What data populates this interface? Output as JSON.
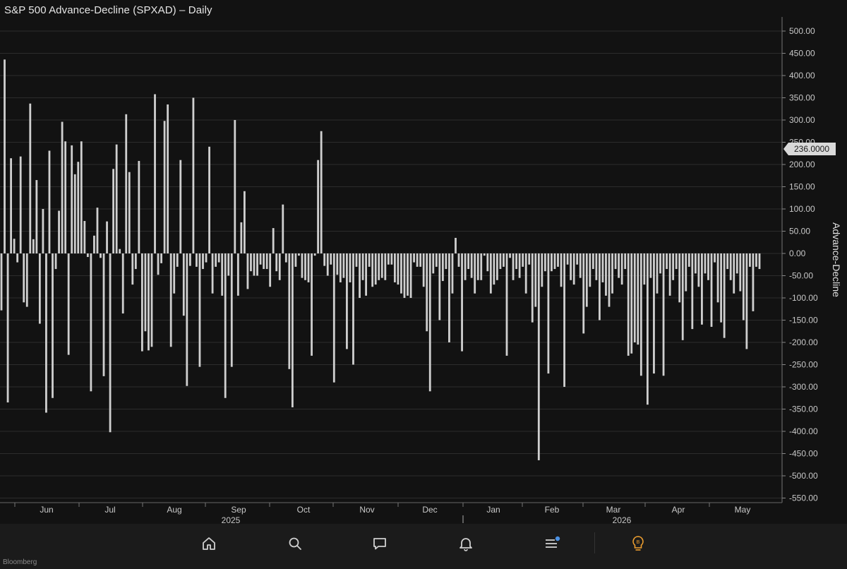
{
  "title": "S&P 500 Advance-Decline (SPXAD) – Daily",
  "brand": "Bloomberg",
  "colors": {
    "background": "#121212",
    "bar": "#cfcfcf",
    "grid": "#2c2c2c",
    "marker_bg": "#d9d9d9",
    "accent_dot": "#4a90e2",
    "brand_icon": "#f0a030"
  },
  "nav": [
    {
      "name": "home-icon"
    },
    {
      "name": "search-icon"
    },
    {
      "name": "chat-icon"
    },
    {
      "name": "bell-icon"
    },
    {
      "name": "menu-icon",
      "badge": true
    },
    {
      "name": "bulb-icon"
    }
  ],
  "chart_data": {
    "type": "bar",
    "ylabel": "Advance-Decline",
    "ylim": [
      -550,
      500
    ],
    "yticks": [
      "500.00",
      "450.00",
      "400.00",
      "350.00",
      "300.00",
      "250.00",
      "200.00",
      "150.00",
      "100.00",
      "50.00",
      "0.00",
      "-50.00",
      "-100.00",
      "-150.00",
      "-200.00",
      "-250.00",
      "-300.00",
      "-350.00",
      "-400.00",
      "-450.00",
      "-500.00",
      "-550.00"
    ],
    "last_value_label": "236.0000",
    "grid": true,
    "x_months": [
      "Jun",
      "Jul",
      "Aug",
      "Sep",
      "Oct",
      "Nov",
      "Dec",
      "Jan",
      "Feb",
      "Mar",
      "Apr",
      "May"
    ],
    "x_years": [
      "2025",
      "2026"
    ],
    "values": [
      -128,
      436,
      -335,
      214,
      33,
      -20,
      218,
      -110,
      -120,
      337,
      32,
      165,
      -158,
      100,
      -358,
      231,
      -325,
      -35,
      96,
      296,
      252,
      -228,
      243,
      178,
      206,
      252,
      73,
      -8,
      -310,
      40,
      103,
      -10,
      -276,
      72,
      -402,
      190,
      245,
      10,
      -135,
      313,
      183,
      -70,
      -35,
      208,
      -220,
      -175,
      -218,
      -210,
      358,
      -48,
      -22,
      298,
      335,
      -210,
      -90,
      -30,
      210,
      -140,
      -298,
      -28,
      350,
      -30,
      -255,
      -35,
      -20,
      240,
      -90,
      -30,
      -20,
      -95,
      -325,
      -50,
      -255,
      300,
      -95,
      70,
      140,
      -80,
      -40,
      -50,
      -50,
      -25,
      -35,
      -35,
      -75,
      57,
      -40,
      -60,
      110,
      -20,
      -260,
      -346,
      -30,
      -5,
      -55,
      -60,
      -65,
      -230,
      -5,
      210,
      275,
      -28,
      -50,
      -25,
      -290,
      -48,
      -65,
      -55,
      -215,
      -65,
      -250,
      -30,
      -100,
      -60,
      -95,
      -30,
      -75,
      -70,
      -60,
      -55,
      -60,
      -25,
      -25,
      -65,
      -70,
      -90,
      -100,
      -95,
      -100,
      -20,
      -30,
      -30,
      -75,
      -175,
      -310,
      -45,
      -30,
      -150,
      -62,
      -35,
      -200,
      -90,
      35,
      -30,
      -220,
      -60,
      -35,
      -55,
      -90,
      -60,
      -60,
      -5,
      -40,
      -90,
      -70,
      -60,
      -35,
      -30,
      -230,
      -10,
      -60,
      -35,
      -55,
      -30,
      -90,
      -25,
      -155,
      -120,
      -465,
      -75,
      -40,
      -270,
      -40,
      -35,
      -30,
      -75,
      -300,
      -25,
      -60,
      -70,
      -25,
      -55,
      -180,
      -120,
      -75,
      -35,
      -60,
      -150,
      -65,
      -95,
      -120,
      -90,
      -35,
      -55,
      -70,
      -35,
      -230,
      -225,
      -200,
      -205,
      -275,
      -70,
      -340,
      -55,
      -270,
      -90,
      -45,
      -275,
      -35,
      -95,
      -60,
      -35,
      -110,
      -195,
      -85,
      -30,
      -170,
      -45,
      -75,
      -160,
      -45,
      -60,
      -165,
      -20,
      -110,
      -155,
      -190,
      -35,
      -60,
      -90,
      -45,
      -85,
      -150,
      -215,
      -30,
      -130,
      -30,
      -35
    ]
  }
}
